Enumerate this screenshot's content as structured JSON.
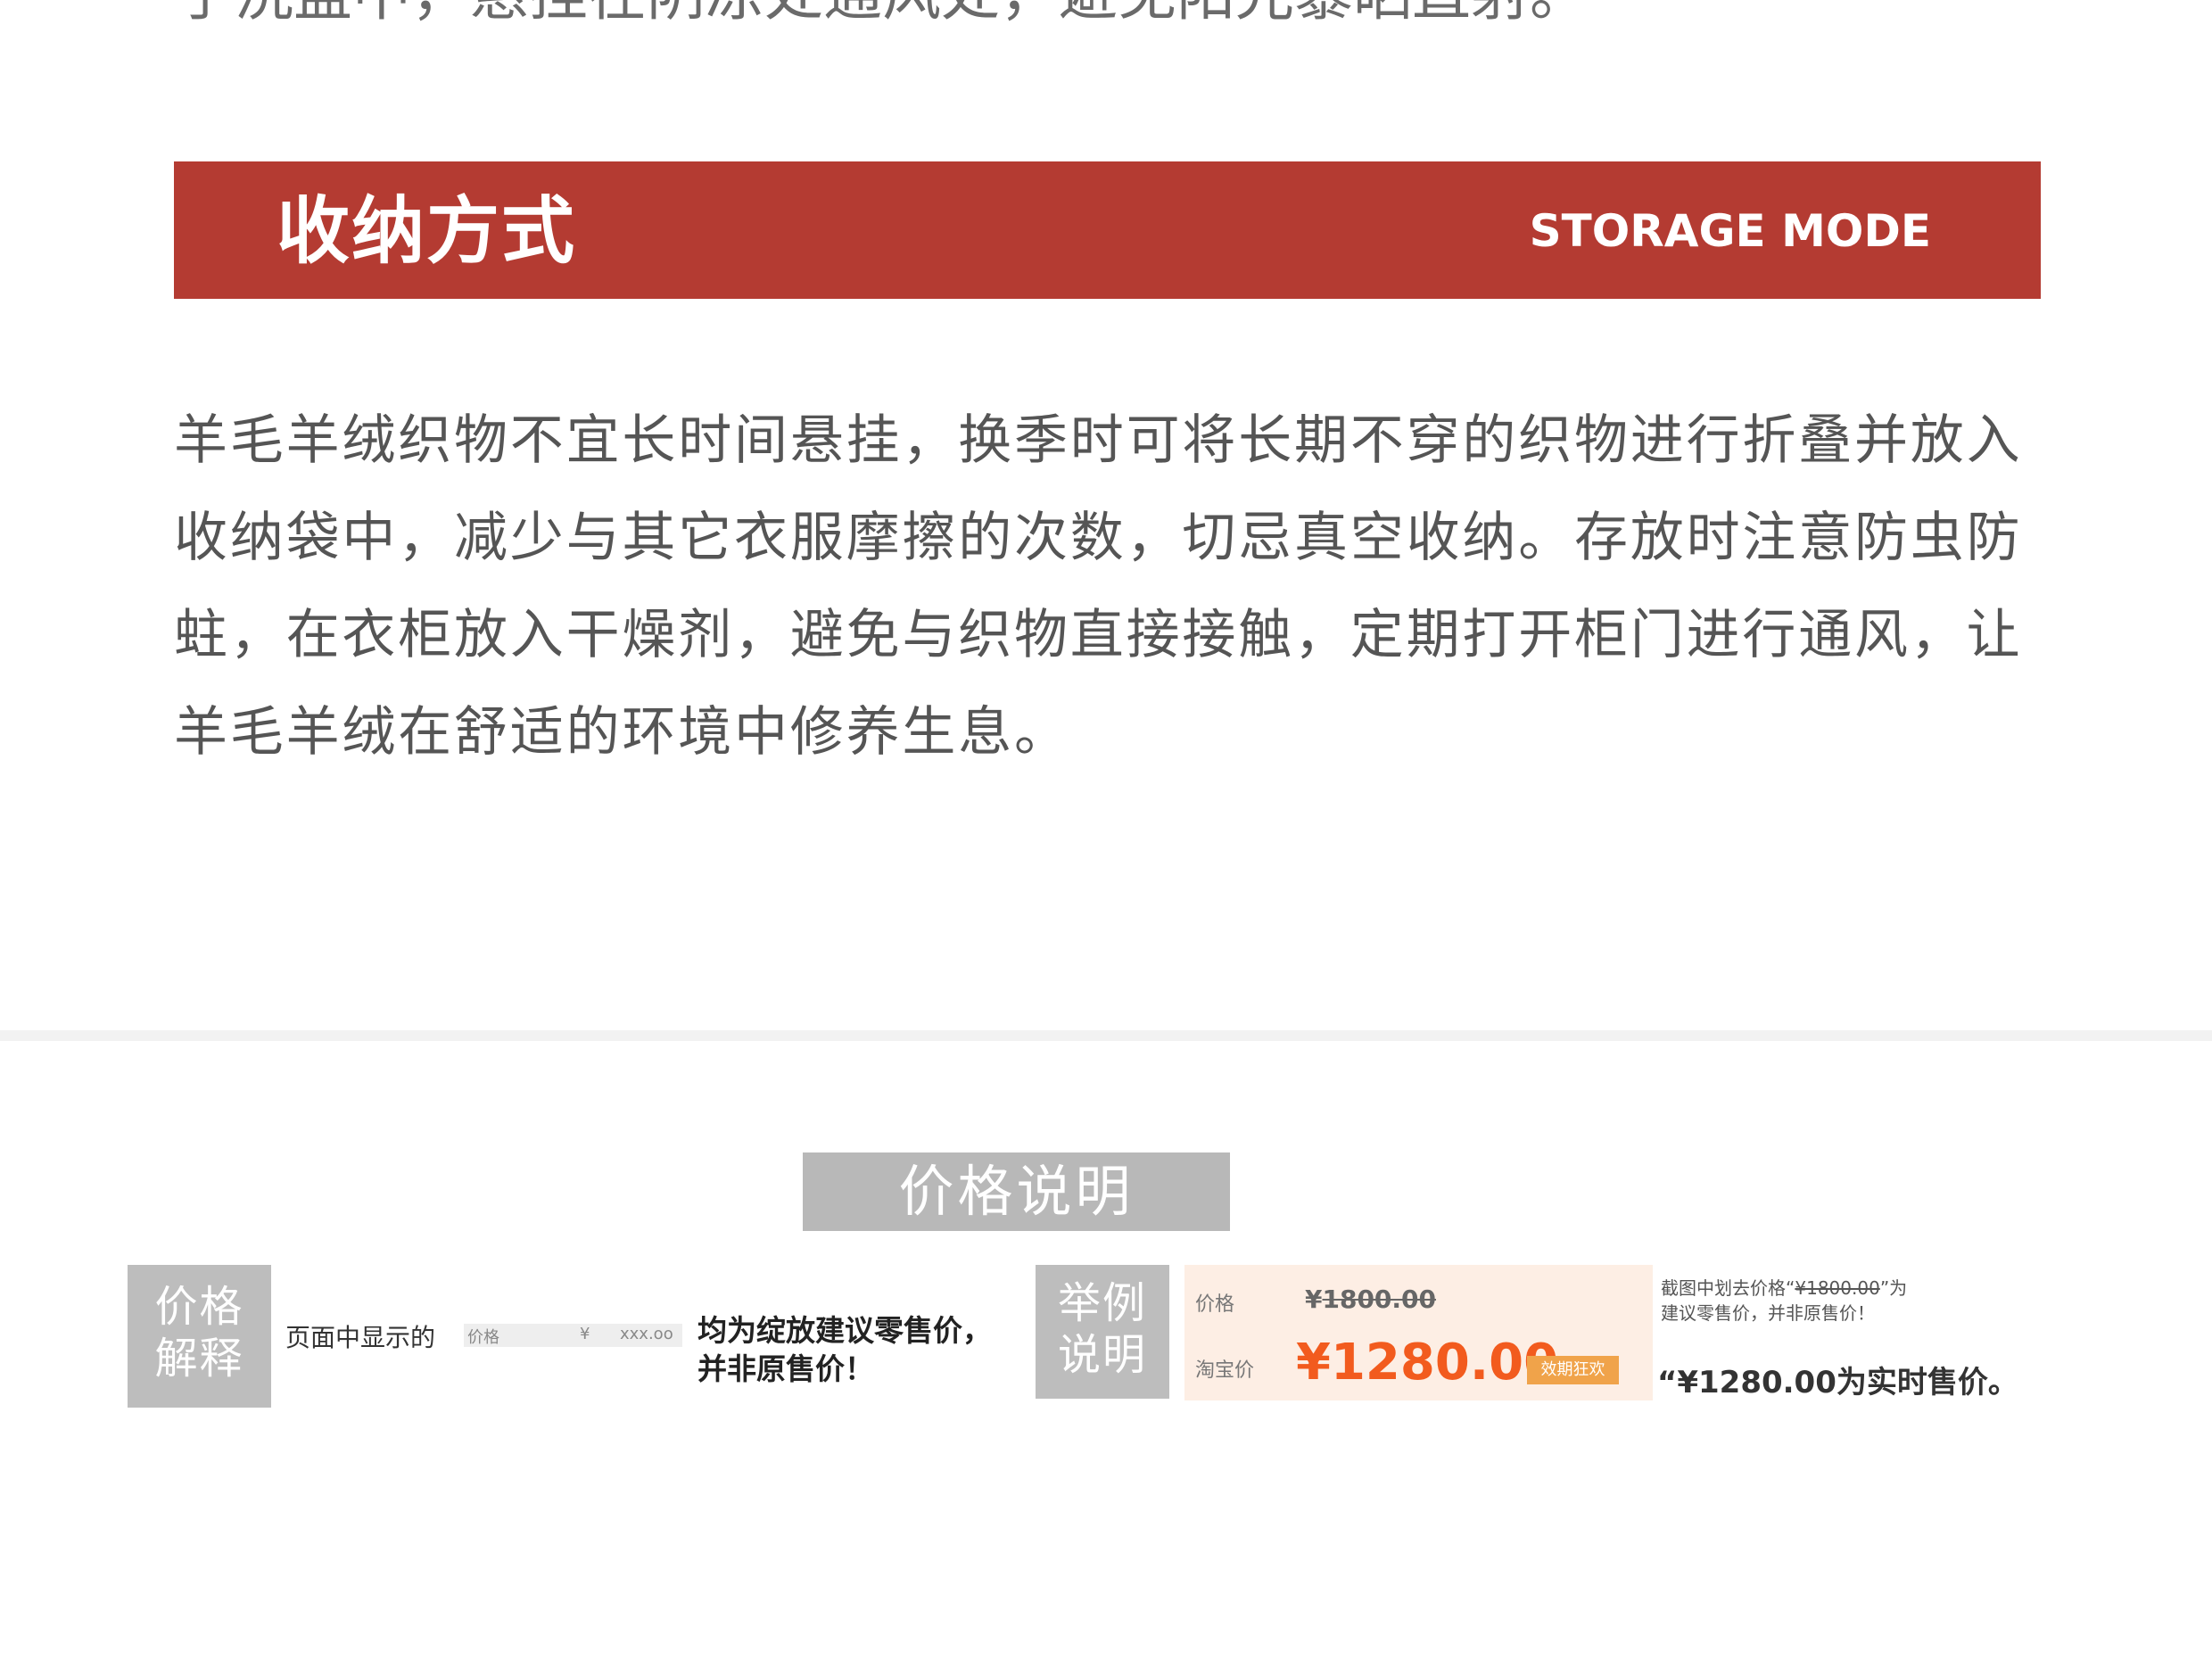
{
  "top_cut_text": "手洗盆中，悬挂在阴凉处通风处，避免阳光暴晒直射。",
  "storage": {
    "title_zh": "收纳方式",
    "title_en": "STORAGE MODE",
    "paragraph": "羊毛羊绒织物不宜长时间悬挂，换季时可将长期不穿的织物进行折叠并放入收纳袋中，减少与其它衣服摩擦的次数，切忌真空收纳。存放时注意防虫防蛀，在衣柜放入干燥剂，避免与织物直接接触，定期打开柜门进行通风，让羊毛羊绒在舒适的环境中修养生息。"
  },
  "price_notice": {
    "title": "价格说明",
    "explain_box_line1": "价格",
    "explain_box_line2": "解释",
    "shown_label": "页面中显示的",
    "mini_field_label": "价格",
    "mini_field_currency": "¥",
    "mini_field_value": "xxx.oo",
    "claim_line1": "均为绽放建议零售价，",
    "claim_line2": "并非原售价！",
    "example_box_line1": "举例",
    "example_box_line2": "说明",
    "example": {
      "price_label": "价格",
      "currency": "¥",
      "original_price": "1800.00",
      "taobao_label": "淘宝价",
      "current_price": "¥1280.00",
      "tag": "效期狂欢"
    },
    "note_small_prefix": "截图中划去价格“",
    "note_small_strike": "¥1800.00",
    "note_small_suffix": "”为",
    "note_small_line2": "建议零售价，并非原售价！",
    "note_big": "“¥1280.00为实时售价。"
  },
  "colors": {
    "banner": "#b43b32",
    "gray_box": "#bdbdbd",
    "price_red": "#f25b1e",
    "example_bg": "#fdeee4"
  }
}
